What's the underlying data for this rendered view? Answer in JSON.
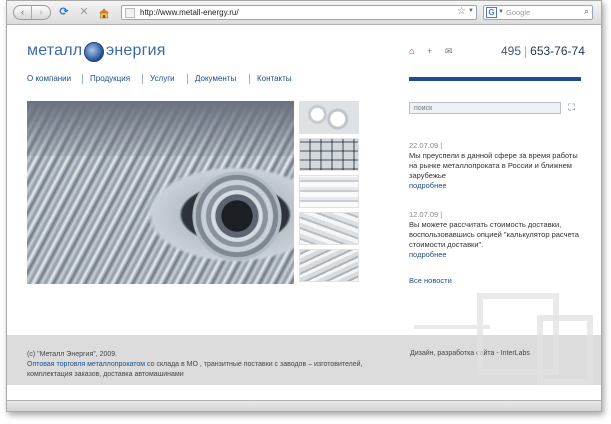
{
  "browser": {
    "back_glyph": "‹",
    "forward_glyph": "›",
    "reload_glyph": "⟳",
    "stop_glyph": "✕",
    "home_glyph": "⌂",
    "url": "http://www.metall-energy.ru/",
    "star_glyph": "☆",
    "dropdown_glyph": "▼",
    "search_engine_letter": "G",
    "search_placeholder": "Google",
    "search_glyph": "⌕"
  },
  "site": {
    "logo_word1": "металл",
    "logo_word2": "энергия",
    "phone_code": "495",
    "phone_sep": "|",
    "phone_number": "653-76-74",
    "top_icons": {
      "home": "⌂",
      "plus": "+",
      "mail": "✉"
    },
    "nav": [
      "О компании",
      "Продукция",
      "Услуги",
      "Документы",
      "Контакты"
    ],
    "search_placeholder": "поиск",
    "search_go_glyph": "⛶",
    "news": [
      {
        "date": "22.07.09 |",
        "text": "Мы преуспели в данной сфере за время работы на рынке металлопроката в России и ближнем зарубежье",
        "more": "подробнее"
      },
      {
        "date": "12.07.09 |",
        "text": "Вы можете рассчитать стоимость доставки, воспользовавшись опцией \"калькулятор расчета стоимости доставки\".",
        "more": "подробнее"
      }
    ],
    "all_news": "Все новости",
    "footer": {
      "copyright": "(с) \"Металл Энергия\", 2009.",
      "link_text": "Оптовая торговля металлопрокатом",
      "tail_text": " со склада в МО , транзитные поставки с заводов – изготовителей, комплектация заказов, доставка автомашинами",
      "credits": "Дизайн, разработка сайта - InterLabs"
    }
  },
  "colors": {
    "brand_blue": "#1d4e8d",
    "accent_red": "#c62828",
    "footer_gray": "#dcdcdc"
  }
}
